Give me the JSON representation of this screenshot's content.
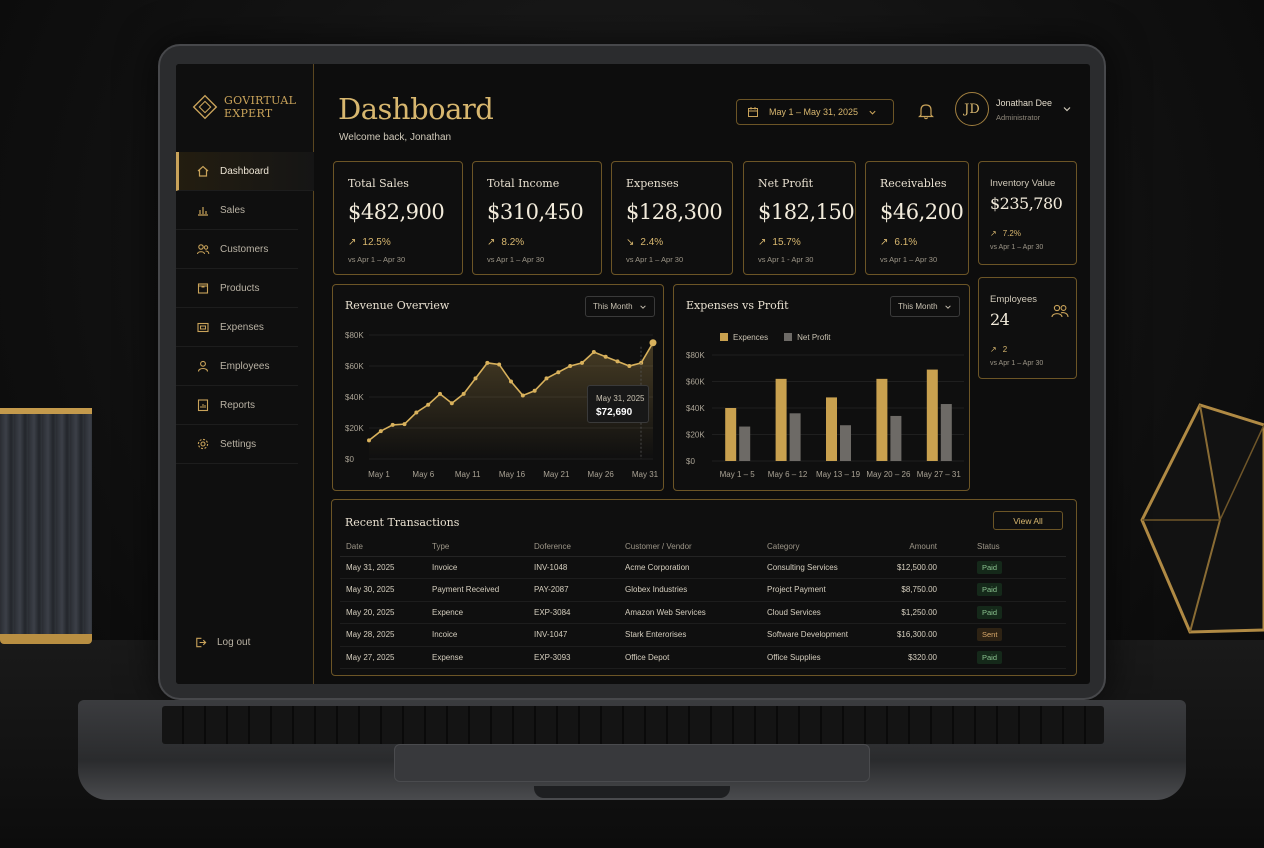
{
  "brand": {
    "line1": "GOVIRTUAL",
    "line2": "EXPERT",
    "accent": "#c9a35a"
  },
  "sidebar": {
    "items": [
      {
        "label": "Dashboard",
        "icon": "home-icon",
        "active": true
      },
      {
        "label": "Sales",
        "icon": "bar-chart-icon"
      },
      {
        "label": "Customers",
        "icon": "users-icon"
      },
      {
        "label": "Products",
        "icon": "box-icon"
      },
      {
        "label": "Expenses",
        "icon": "wallet-icon"
      },
      {
        "label": "Employees",
        "icon": "user-icon"
      },
      {
        "label": "Reports",
        "icon": "report-icon"
      },
      {
        "label": "Settings",
        "icon": "gear-icon"
      }
    ],
    "logout": "Log out"
  },
  "header": {
    "title": "Dashboard",
    "welcome": "Welcome back, Jonathan",
    "date_range": "May 1 – May 31, 2025",
    "user": {
      "initials": "JD",
      "name": "Jonathan Dee",
      "role": "Administrator"
    }
  },
  "stats": [
    {
      "label": "Total Sales",
      "value": "$482,900",
      "change": "12.5%",
      "direction": "up",
      "period": "vs Apr 1 – Apr 30"
    },
    {
      "label": "Total Income",
      "value": "$310,450",
      "change": "8.2%",
      "direction": "up",
      "period": "vs Apr 1 – Apr 30"
    },
    {
      "label": "Expenses",
      "value": "$128,300",
      "change": "2.4%",
      "direction": "down",
      "period": "vs Apr 1 – Apr 30"
    },
    {
      "label": "Net Profit",
      "value": "$182,150",
      "change": "15.7%",
      "direction": "up",
      "period": "vs Apr 1 - Apr 30"
    },
    {
      "label": "Receivables",
      "value": "$46,200",
      "change": "6.1%",
      "direction": "up",
      "period": "vs Apr 1 – Apr 30"
    },
    {
      "label": "Inventory Value",
      "value": "$235,780",
      "change": "7.2%",
      "direction": "up",
      "period": "vs Apr 1 – Apr 30"
    },
    {
      "label": "Employees",
      "value": "24",
      "change": "2",
      "direction": "up",
      "period": "vs Apr 1 – Apr 30"
    }
  ],
  "revenue_panel": {
    "title": "Revenue Overview",
    "filter": "This Month",
    "tooltip_date": "May 31, 2025",
    "tooltip_value": "$72,690"
  },
  "expenses_panel": {
    "title": "Expenses vs Profit",
    "filter": "This Month"
  },
  "chart_data": [
    {
      "type": "area",
      "title": "Revenue Overview",
      "x_ticks": [
        "May 1",
        "May 6",
        "May 11",
        "May 16",
        "May 21",
        "May 26",
        "May 31"
      ],
      "y_ticks": [
        "$0",
        "$20K",
        "$40K",
        "$60K",
        "$80K"
      ],
      "ylim": [
        0,
        80000
      ],
      "x": [
        1,
        2,
        3,
        4,
        5,
        6,
        7,
        8,
        9,
        10,
        11,
        12,
        13,
        14,
        15,
        16,
        17,
        18,
        19,
        20,
        21,
        22,
        23,
        24,
        25
      ],
      "values": [
        12000,
        18000,
        22000,
        22500,
        30000,
        35000,
        42000,
        36000,
        42000,
        52000,
        62000,
        61000,
        50000,
        41000,
        44000,
        52000,
        56000,
        60000,
        62000,
        69000,
        66000,
        63000,
        60000,
        62000,
        75000
      ],
      "color": "#d8b15c"
    },
    {
      "type": "bar",
      "title": "Expenses vs Profit",
      "categories": [
        "May 1 – 5",
        "May 6 – 12",
        "May 13 – 19",
        "May 20 – 26",
        "May 27 – 31"
      ],
      "y_ticks": [
        "$0",
        "$20K",
        "$40K",
        "$60K",
        "$80K"
      ],
      "ylim": [
        0,
        80000
      ],
      "legend": "top-left",
      "series": [
        {
          "name": "Expences",
          "values": [
            40000,
            62000,
            48000,
            62000,
            69000
          ],
          "color": "#c9a14f"
        },
        {
          "name": "Net Profit",
          "values": [
            26000,
            36000,
            27000,
            34000,
            43000
          ],
          "color": "#6d6a66"
        }
      ]
    }
  ],
  "transactions": {
    "title": "Recent Transactions",
    "view_all": "View All",
    "columns": [
      "Date",
      "Type",
      "Doference",
      "Customer / Vendor",
      "Category",
      "Amount",
      "Status"
    ],
    "rows": [
      [
        "May 31, 2025",
        "Invoice",
        "INV-1048",
        "Acme Corporation",
        "Consulting Services",
        "$12,500.00",
        "Paid"
      ],
      [
        "May 30, 2025",
        "Payment Received",
        "PAY-2087",
        "Globex Industries",
        "Project Payment",
        "$8,750.00",
        "Paid"
      ],
      [
        "May 20, 2025",
        "Expence",
        "EXP-3084",
        "Amazon Web Services",
        "Cloud Services",
        "$1,250.00",
        "Paid"
      ],
      [
        "May 28, 2025",
        "Incoice",
        "INV-1047",
        "Stark Enterorises",
        "Software Development",
        "$16,300.00",
        "Sent"
      ],
      [
        "May 27, 2025",
        "Expense",
        "EXP-3093",
        "Office Depot",
        "Office Supplies",
        "$320.00",
        "Paid"
      ]
    ]
  }
}
